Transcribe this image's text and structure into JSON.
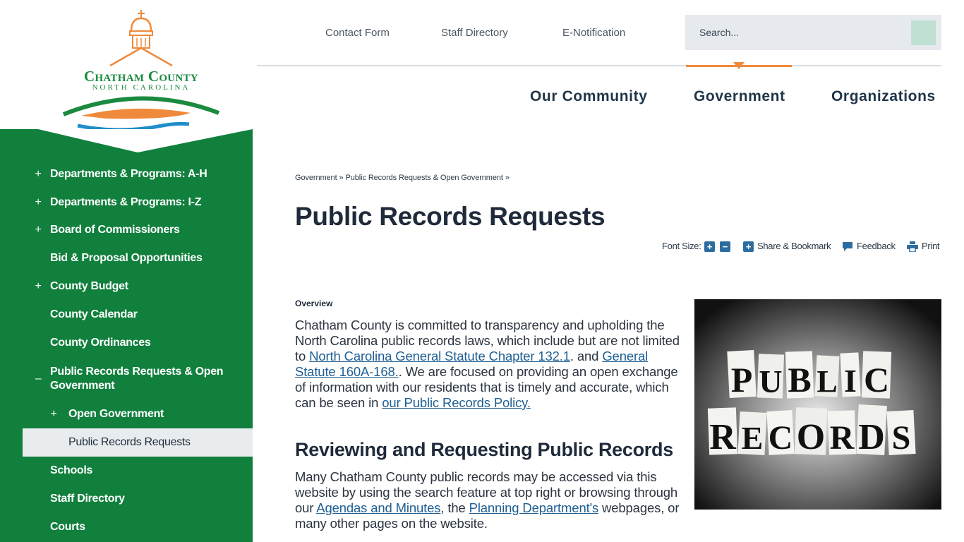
{
  "logo": {
    "title": "Chatham County",
    "subtitle": "NORTH CAROLINA"
  },
  "utility_nav": {
    "links": [
      "Contact Form",
      "Staff Directory",
      "E-Notification"
    ],
    "search_placeholder": "Search..."
  },
  "main_nav": [
    "Our Community",
    "Government",
    "Organizations"
  ],
  "sidebar": {
    "items": [
      {
        "label": "Departments & Programs: A-H",
        "toggle": "+"
      },
      {
        "label": "Departments & Programs: I-Z",
        "toggle": "+"
      },
      {
        "label": "Board of Commissioners",
        "toggle": "+"
      },
      {
        "label": "Bid & Proposal Opportunities",
        "toggle": ""
      },
      {
        "label": "County Budget",
        "toggle": "+"
      },
      {
        "label": "County Calendar",
        "toggle": ""
      },
      {
        "label": "County Ordinances",
        "toggle": ""
      },
      {
        "label": "Public Records Requests & Open Government",
        "toggle": "–"
      },
      {
        "label": "Open Government",
        "toggle": "+"
      },
      {
        "label": "Public Records Requests",
        "toggle": ""
      },
      {
        "label": "Schools",
        "toggle": ""
      },
      {
        "label": "Staff Directory",
        "toggle": ""
      },
      {
        "label": "Courts",
        "toggle": ""
      }
    ]
  },
  "breadcrumb": {
    "items": [
      "Government",
      "Public Records Requests & Open Government"
    ],
    "separator": "»"
  },
  "page": {
    "title": "Public Records Requests"
  },
  "tools": {
    "font_size_label": "Font Size:",
    "share_label": "Share & Bookmark",
    "feedback_label": "Feedback",
    "print_label": "Print"
  },
  "content": {
    "overview_label": "Overview",
    "p1_a": "Chatham County is committed to transparency and upholding the North Carolina public records laws, which include but are not limited to ",
    "p1_link1": "North Carolina General Statute Chapter 132.1",
    "p1_b": ". and ",
    "p1_link2": "General Statute 160A-168.",
    "p1_c": ". We are focused on providing an open exchange of information with our residents that is timely and accurate, which can be seen in ",
    "p1_link3": "our Public Records Policy. ",
    "heading": "Reviewing and Requesting Public Records",
    "p2_a": "Many Chatham County public records may be accessed via this website by using the search feature at top right or browsing through our ",
    "p2_link1": "Agendas and Minutes",
    "p2_b": ", the ",
    "p2_link2": "Planning Department's",
    "p2_c": " webpages, or many other pages on the website."
  },
  "image": {
    "line1": [
      "P",
      "U",
      "B",
      "L",
      "I",
      "C"
    ],
    "line2": [
      "R",
      "E",
      "C",
      "O",
      "R",
      "D",
      "S"
    ]
  },
  "colors": {
    "sidebar_green": "#11803d",
    "accent_orange": "#ef8a3c",
    "link_blue": "#1f5f93",
    "nav_dark": "#1f3448"
  }
}
